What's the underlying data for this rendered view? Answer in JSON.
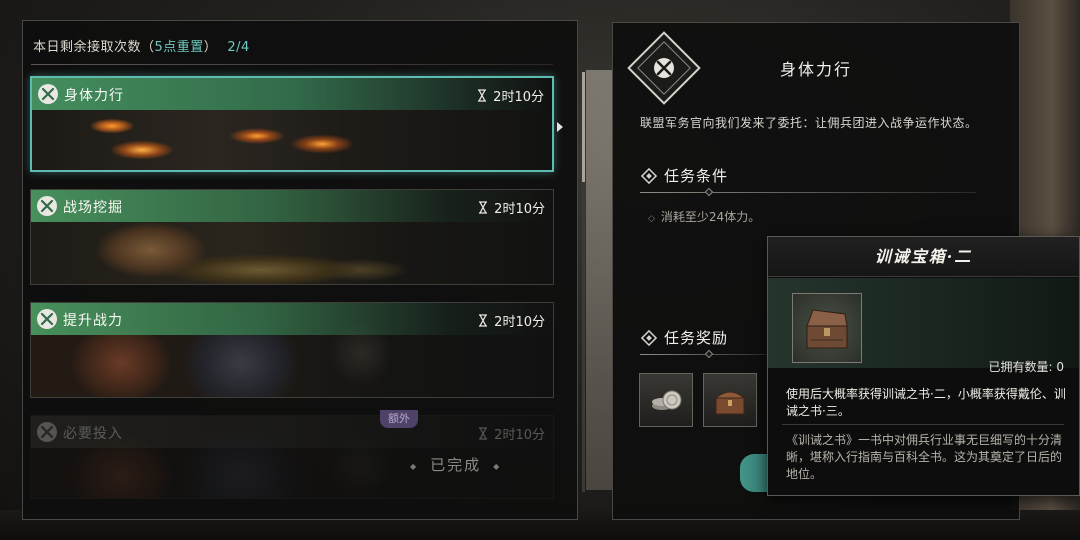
{
  "header": {
    "label": "本日剩余接取次数（",
    "reset_hint": "5点重置",
    "close_paren": "）",
    "count": "2/4"
  },
  "quests": [
    {
      "title": "身体力行",
      "timer": "2时10分",
      "icon": "crossed-swords-icon",
      "selected": true,
      "completed": false
    },
    {
      "title": "战场挖掘",
      "timer": "2时10分",
      "icon": "crossed-swords-icon",
      "selected": false,
      "completed": false
    },
    {
      "title": "提升战力",
      "timer": "2时10分",
      "icon": "crossed-swords-icon",
      "selected": false,
      "completed": false
    },
    {
      "title": "必要投入",
      "timer": "2时10分",
      "icon": "crossed-swords-icon",
      "selected": false,
      "completed": true
    }
  ],
  "extra_badge": "额外",
  "completed_label": "已完成",
  "detail": {
    "title": "身体力行",
    "description": "联盟军务官向我们发来了委托：让佣兵团进入战争运作状态。",
    "condition_heading": "任务条件",
    "condition_text": "消耗至少24体力。",
    "reward_heading": "任务奖励"
  },
  "rewards": [
    {
      "name": "coins-icon"
    },
    {
      "name": "treasure-chest-icon"
    }
  ],
  "tooltip": {
    "title": "训诫宝箱·二",
    "owned": "已拥有数量: 0",
    "description": "使用后大概率获得训诫之书·二，小概率获得戴伦、训诫之书·三。",
    "lore": "《训诫之书》一书中对佣兵行业事无巨细写的十分清晰，堪称入行指南与百科全书。这为其奠定了日后的地位。"
  },
  "colors": {
    "accent": "#5ebbb0",
    "quest_bar": "#4a9660",
    "highlight_text": "#6fc9c0"
  }
}
